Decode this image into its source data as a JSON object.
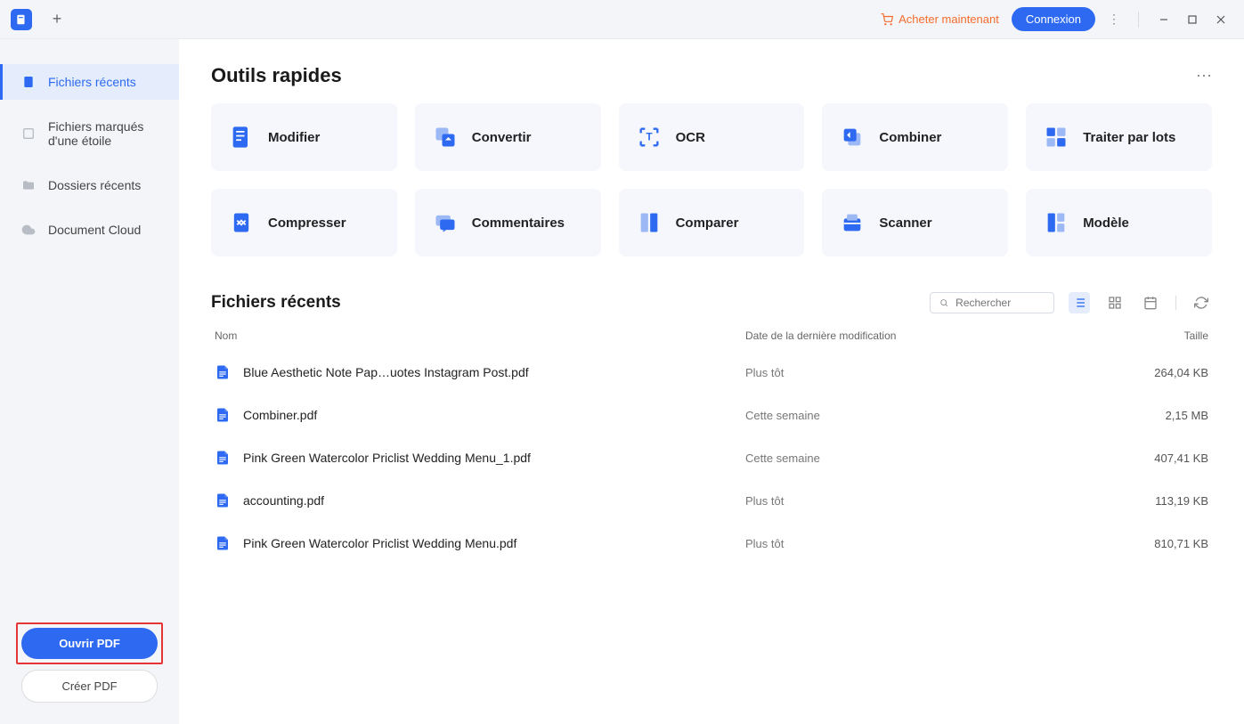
{
  "titlebar": {
    "buy_label": "Acheter maintenant",
    "login_label": "Connexion"
  },
  "sidebar": {
    "items": [
      {
        "label": "Fichiers récents"
      },
      {
        "label": "Fichiers marqués d'une étoile"
      },
      {
        "label": "Dossiers récents"
      },
      {
        "label": "Document Cloud"
      }
    ],
    "open_label": "Ouvrir PDF",
    "create_label": "Créer PDF"
  },
  "main": {
    "tools_title": "Outils rapides",
    "tools": [
      {
        "label": "Modifier"
      },
      {
        "label": "Convertir"
      },
      {
        "label": "OCR"
      },
      {
        "label": "Combiner"
      },
      {
        "label": "Traiter par lots"
      },
      {
        "label": "Compresser"
      },
      {
        "label": "Commentaires"
      },
      {
        "label": "Comparer"
      },
      {
        "label": "Scanner"
      },
      {
        "label": "Modèle"
      }
    ],
    "recent_title": "Fichiers récents",
    "search_placeholder": "Rechercher",
    "columns": {
      "name": "Nom",
      "date": "Date de la dernière modification",
      "size": "Taille"
    },
    "files": [
      {
        "name": "Blue Aesthetic Note Pap…uotes Instagram Post.pdf",
        "date": "Plus tôt",
        "size": "264,04 KB"
      },
      {
        "name": "Combiner.pdf",
        "date": "Cette semaine",
        "size": "2,15 MB"
      },
      {
        "name": "Pink Green Watercolor Priclist Wedding Menu_1.pdf",
        "date": "Cette semaine",
        "size": "407,41 KB"
      },
      {
        "name": "accounting.pdf",
        "date": "Plus tôt",
        "size": "113,19 KB"
      },
      {
        "name": "Pink Green Watercolor Priclist Wedding Menu.pdf",
        "date": "Plus tôt",
        "size": "810,71 KB"
      }
    ]
  }
}
